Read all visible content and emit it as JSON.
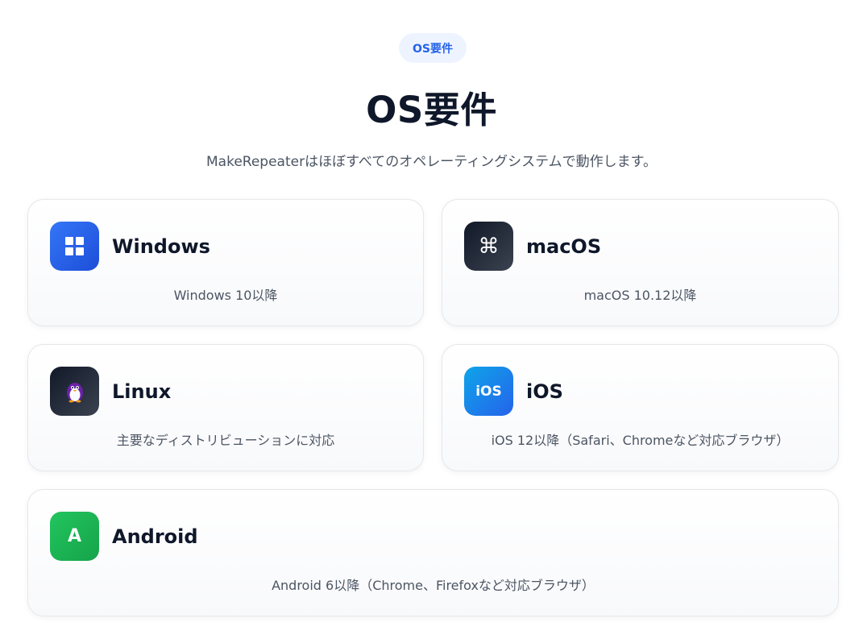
{
  "section": {
    "badge": "OS要件",
    "title": "OS要件",
    "subtitle": "MakeRepeaterはほぼすべてのオペレーティングシステムで動作します。"
  },
  "cards": [
    {
      "name": "Windows",
      "desc": "Windows 10以降",
      "icon": "windows-logo-icon",
      "colors": [
        "#2f6df6",
        "#1d4ed8"
      ]
    },
    {
      "name": "macOS",
      "desc": "macOS 10.12以降",
      "icon": "command-key-icon",
      "glyph": "⌘",
      "colors": [
        "#111827",
        "#374151"
      ]
    },
    {
      "name": "Linux",
      "desc": "主要なディストリビューションに対応",
      "icon": "penguin-icon",
      "glyph": "🐧",
      "colors": [
        "#111827",
        "#374151"
      ]
    },
    {
      "name": "iOS",
      "desc": "iOS 12以降（Safari、Chromeなど対応ブラウザ）",
      "icon": "ios-icon",
      "glyph": "iOS",
      "colors": [
        "#0ea5e9",
        "#2563eb"
      ]
    },
    {
      "name": "Android",
      "desc": "Android 6以降（Chrome、Firefoxなど対応ブラウザ）",
      "icon": "android-icon",
      "glyph": "A",
      "colors": [
        "#22c55e",
        "#16a34a"
      ]
    }
  ]
}
